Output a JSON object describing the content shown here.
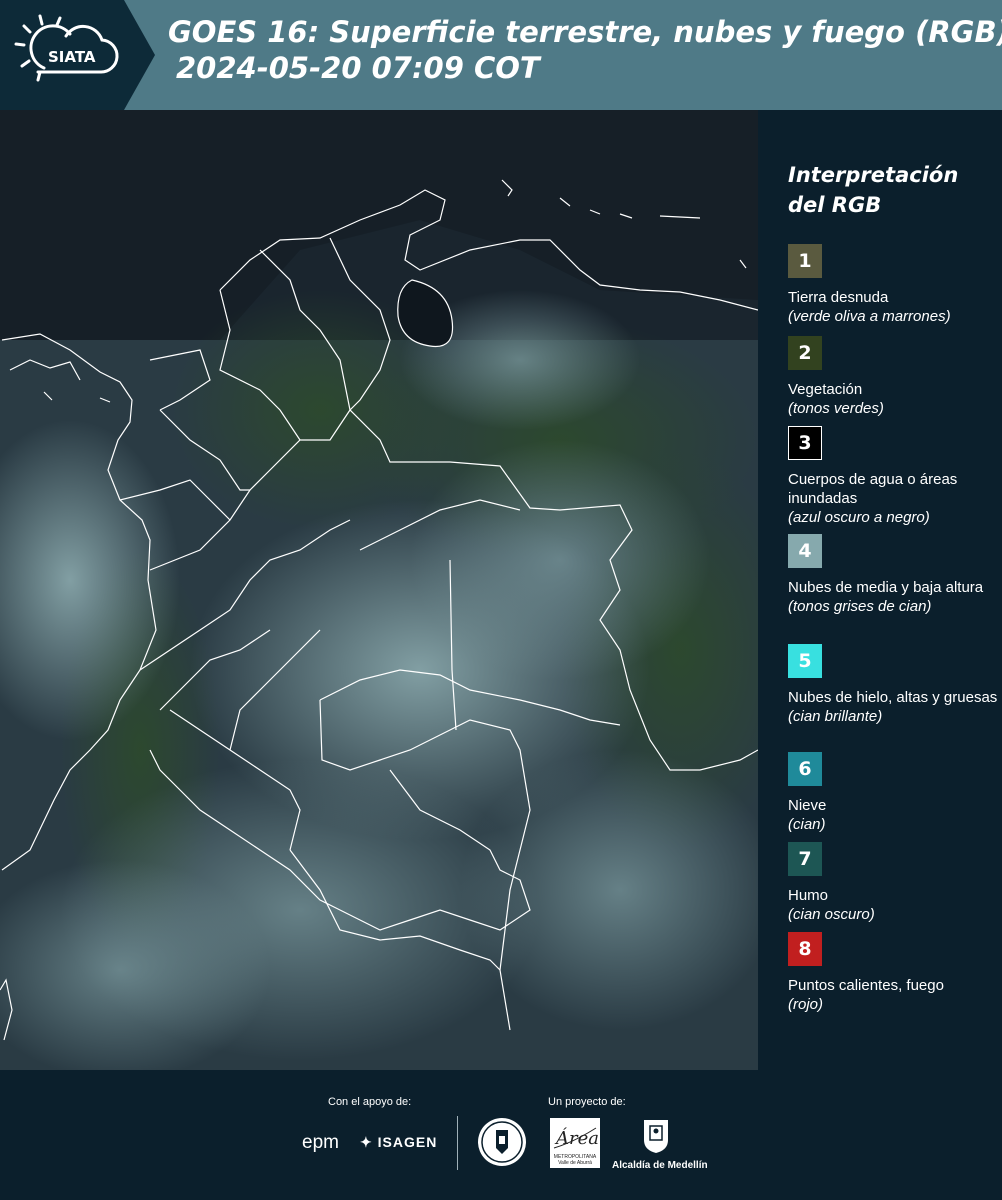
{
  "header": {
    "title_line1": "GOES 16: Superficie terrestre, nubes y fuego (RGB)",
    "title_line2": "2024-05-20 07:09 COT",
    "logo_text": "SIATA",
    "colors": {
      "band": "#4f7a87",
      "dark": "#0d2a38"
    }
  },
  "legend": {
    "title": "Interpretación del RGB",
    "items": [
      {
        "number": "1",
        "label": "Tierra desnuda",
        "note": "(verde oliva a marrones)",
        "color": "#5a5a3f"
      },
      {
        "number": "2",
        "label": "Vegetación",
        "note": "(tonos verdes)",
        "color": "#32421f"
      },
      {
        "number": "3",
        "label": "Cuerpos de agua o áreas inundadas",
        "note": "(azul oscuro a negro)",
        "color": "#000000"
      },
      {
        "number": "4",
        "label": "Nubes de media y baja altura",
        "note": "(tonos grises de cian)",
        "color": "#86a9ad"
      },
      {
        "number": "5",
        "label": "Nubes de hielo, altas y gruesas",
        "note": "(cian brillante)",
        "color": "#38e0e0"
      },
      {
        "number": "6",
        "label": "Nieve",
        "note": "(cian)",
        "color": "#1f8a9a"
      },
      {
        "number": "7",
        "label": "Humo",
        "note": "(cian oscuro)",
        "color": "#1d5654"
      },
      {
        "number": "8",
        "label": "Puntos calientes, fuego",
        "note": "(rojo)",
        "color": "#c11f1f"
      }
    ]
  },
  "footer": {
    "support_label": "Con el apoyo de:",
    "project_label": "Un proyecto de:",
    "sponsors": [
      "epm",
      "ISAGEN"
    ],
    "partners": {
      "amva_text": "METROPOLITANA Valle de Aburrá",
      "amva_script": "Área",
      "alcaldia": "Alcaldía de Medellín"
    }
  }
}
